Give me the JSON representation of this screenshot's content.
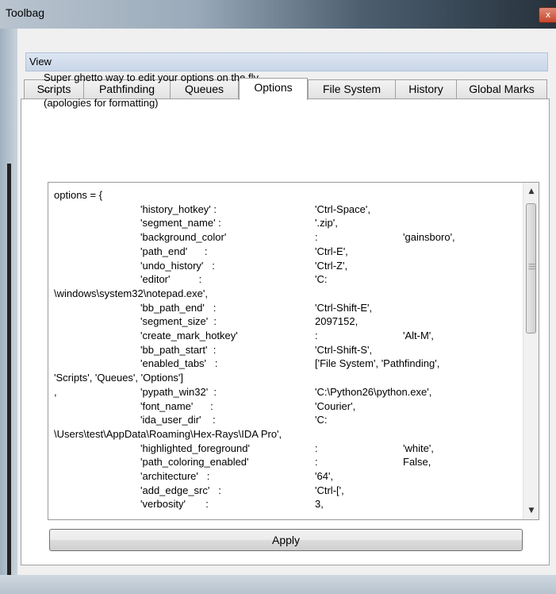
{
  "window": {
    "title": "Toolbag",
    "close_glyph": "x"
  },
  "view_bar": {
    "label": "View"
  },
  "tabs": [
    {
      "label": "Scripts",
      "active": false
    },
    {
      "label": "Pathfinding",
      "active": false
    },
    {
      "label": "Queues",
      "active": false
    },
    {
      "label": "Options",
      "active": true
    },
    {
      "label": "File System",
      "active": false
    },
    {
      "label": "History",
      "active": false
    },
    {
      "label": "Global Marks",
      "active": false
    }
  ],
  "options_tab": {
    "intro": [
      "Super ghetto way to edit your options on the fly",
      "--",
      "(apologies for formatting)"
    ],
    "code_lines": [
      [
        "options = {",
        "",
        "",
        ""
      ],
      [
        "",
        "'history_hotkey' :",
        "'Ctrl-Space',",
        ""
      ],
      [
        "",
        "'segment_name' :",
        "'.zip',",
        ""
      ],
      [
        "",
        "'background_color'",
        ":",
        "'gainsboro',"
      ],
      [
        "",
        "'path_end'      :",
        "'Ctrl-E',",
        ""
      ],
      [
        "",
        "'undo_history'   :",
        "'Ctrl-Z',",
        ""
      ],
      [
        "",
        "'editor'          :",
        "'C:",
        ""
      ],
      [
        "\\windows\\system32\\notepad.exe',",
        "",
        "",
        ""
      ],
      [
        "",
        "'bb_path_end'   :",
        "'Ctrl-Shift-E',",
        ""
      ],
      [
        "",
        "'segment_size'  :",
        "2097152,",
        ""
      ],
      [
        "",
        "'create_mark_hotkey'",
        ":",
        "'Alt-M',"
      ],
      [
        "",
        "'bb_path_start'  :",
        "'Ctrl-Shift-S',",
        ""
      ],
      [
        "",
        "'enabled_tabs'   :",
        "['File System', 'Pathfinding',",
        ""
      ],
      [
        "'Scripts', 'Queues', 'Options']",
        "",
        "",
        ""
      ],
      [
        ",",
        "'pypath_win32'  :",
        "'C:\\Python26\\python.exe',",
        ""
      ],
      [
        "",
        "'font_name'      :",
        "'Courier',",
        ""
      ],
      [
        "",
        "'ida_user_dir'    :",
        "'C:",
        ""
      ],
      [
        "\\Users\\test\\AppData\\Roaming\\Hex-Rays\\IDA Pro',",
        "",
        "",
        ""
      ],
      [
        "",
        "'highlighted_foreground'",
        ":",
        "'white',"
      ],
      [
        "",
        "'path_coloring_enabled'",
        ":",
        "False,"
      ],
      [
        "",
        "'architecture'   :",
        "'64',",
        ""
      ],
      [
        "",
        "'add_edge_src'   :",
        "'Ctrl-[',",
        ""
      ],
      [
        "",
        "'verbosity'       :",
        "3,",
        ""
      ]
    ],
    "apply_label": "Apply"
  }
}
